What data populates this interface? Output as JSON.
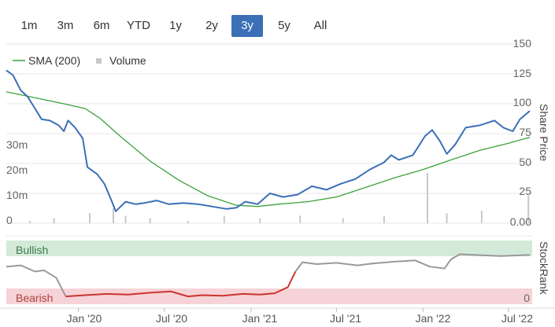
{
  "range_selector": {
    "buttons": [
      "1m",
      "3m",
      "6m",
      "YTD",
      "1y",
      "2y",
      "3y",
      "5y",
      "All"
    ],
    "active": "3y"
  },
  "colors": {
    "price": "#3b6fb6",
    "sma": "#3aa33a",
    "volume": "#c8c8c8",
    "rank": "#999999",
    "rank_red": "#cc3333",
    "bullish_band": "#d3ead9",
    "bearish_band": "#f6d3d6",
    "active_button": "#3b6fb6"
  },
  "chart_data": [
    {
      "type": "line",
      "legend": {
        "placement": "top-left",
        "items": [
          "SMA (200)",
          "Volume"
        ]
      },
      "y_axis_right": {
        "label": "Share Price",
        "ticks": [
          "0.00",
          "25",
          "50",
          "75",
          "100",
          "125",
          "150"
        ],
        "range": [
          0,
          150
        ]
      },
      "y_axis_left": {
        "label": "",
        "ticks": [
          "0",
          "10m",
          "20m",
          "30m"
        ],
        "range": [
          0,
          40
        ]
      },
      "x_axis": {
        "ticks": [
          "Jan '20",
          "Jul '20",
          "Jan '21",
          "Jul '21",
          "Jan '22",
          "Jul '22"
        ]
      },
      "x_range": [
        "2019-08-01",
        "2022-08-20"
      ],
      "grid": true,
      "series": [
        {
          "name": "Share Price",
          "points": [
            [
              "2019-08-01",
              128
            ],
            [
              "2019-08-15",
              124
            ],
            [
              "2019-09-01",
              111
            ],
            [
              "2019-09-15",
              106
            ],
            [
              "2019-10-01",
              96
            ],
            [
              "2019-10-15",
              87
            ],
            [
              "2019-11-01",
              86
            ],
            [
              "2019-11-20",
              82
            ],
            [
              "2019-12-01",
              77
            ],
            [
              "2019-12-10",
              86
            ],
            [
              "2019-12-25",
              80
            ],
            [
              "2020-01-10",
              71
            ],
            [
              "2020-01-20",
              47
            ],
            [
              "2020-02-10",
              41
            ],
            [
              "2020-02-25",
              33
            ],
            [
              "2020-03-10",
              20
            ],
            [
              "2020-03-20",
              10
            ],
            [
              "2020-04-10",
              18
            ],
            [
              "2020-05-01",
              16
            ],
            [
              "2020-05-20",
              17
            ],
            [
              "2020-06-15",
              19
            ],
            [
              "2020-07-10",
              16
            ],
            [
              "2020-08-10",
              17
            ],
            [
              "2020-09-10",
              16
            ],
            [
              "2020-10-10",
              14
            ],
            [
              "2020-11-10",
              12
            ],
            [
              "2020-12-01",
              13
            ],
            [
              "2020-12-20",
              18
            ],
            [
              "2021-01-15",
              16
            ],
            [
              "2021-02-10",
              25
            ],
            [
              "2021-03-10",
              22
            ],
            [
              "2021-04-10",
              24
            ],
            [
              "2021-05-10",
              31
            ],
            [
              "2021-06-10",
              28
            ],
            [
              "2021-07-10",
              33
            ],
            [
              "2021-08-10",
              37
            ],
            [
              "2021-09-10",
              45
            ],
            [
              "2021-10-10",
              51
            ],
            [
              "2021-10-25",
              57
            ],
            [
              "2021-11-10",
              53
            ],
            [
              "2021-12-10",
              57
            ],
            [
              "2022-01-05",
              73
            ],
            [
              "2022-01-20",
              78
            ],
            [
              "2022-02-05",
              69
            ],
            [
              "2022-02-20",
              58
            ],
            [
              "2022-03-10",
              66
            ],
            [
              "2022-04-01",
              80
            ],
            [
              "2022-05-01",
              82
            ],
            [
              "2022-06-01",
              86
            ],
            [
              "2022-06-20",
              80
            ],
            [
              "2022-07-10",
              77
            ],
            [
              "2022-07-25",
              87
            ],
            [
              "2022-08-15",
              94
            ]
          ]
        },
        {
          "name": "SMA (200)",
          "points": [
            [
              "2019-08-01",
              110
            ],
            [
              "2019-10-01",
              105
            ],
            [
              "2019-12-01",
              100
            ],
            [
              "2020-01-15",
              96
            ],
            [
              "2020-02-15",
              88
            ],
            [
              "2020-04-01",
              72
            ],
            [
              "2020-06-01",
              52
            ],
            [
              "2020-08-01",
              36
            ],
            [
              "2020-10-01",
              23
            ],
            [
              "2020-12-01",
              15
            ],
            [
              "2021-01-15",
              14
            ],
            [
              "2021-03-01",
              16
            ],
            [
              "2021-05-01",
              18
            ],
            [
              "2021-07-01",
              22
            ],
            [
              "2021-09-01",
              30
            ],
            [
              "2021-11-01",
              38
            ],
            [
              "2022-01-01",
              45
            ],
            [
              "2022-03-01",
              53
            ],
            [
              "2022-05-01",
              61
            ],
            [
              "2022-07-01",
              67
            ],
            [
              "2022-08-15",
              72
            ]
          ]
        },
        {
          "name": "Volume",
          "type": "bar",
          "points": [
            [
              "2019-09-20",
              1
            ],
            [
              "2019-11-10",
              2
            ],
            [
              "2020-01-25",
              4
            ],
            [
              "2020-03-15",
              6
            ],
            [
              "2020-04-10",
              3
            ],
            [
              "2020-06-01",
              2
            ],
            [
              "2020-08-20",
              1
            ],
            [
              "2020-11-05",
              3
            ],
            [
              "2021-01-20",
              2
            ],
            [
              "2021-04-15",
              3
            ],
            [
              "2021-07-15",
              2
            ],
            [
              "2021-10-10",
              3
            ],
            [
              "2022-01-10",
              20
            ],
            [
              "2022-02-20",
              4
            ],
            [
              "2022-05-05",
              5
            ],
            [
              "2022-08-12",
              11
            ]
          ]
        }
      ]
    },
    {
      "type": "line",
      "y_axis_right": {
        "label": "StockRank",
        "ticks": [
          "0"
        ],
        "range": [
          0,
          100
        ]
      },
      "bands": [
        "Bullish",
        "Bearish"
      ],
      "series": [
        {
          "name": "StockRank",
          "points": [
            [
              "2019-08-01",
              58
            ],
            [
              "2019-09-01",
              60
            ],
            [
              "2019-10-01",
              50
            ],
            [
              "2019-10-20",
              52
            ],
            [
              "2019-11-15",
              40
            ],
            [
              "2019-12-05",
              10
            ],
            [
              "2020-01-15",
              12
            ],
            [
              "2020-03-01",
              14
            ],
            [
              "2020-04-15",
              13
            ],
            [
              "2020-06-01",
              16
            ],
            [
              "2020-07-15",
              18
            ],
            [
              "2020-08-20",
              10
            ],
            [
              "2020-09-20",
              12
            ],
            [
              "2020-11-01",
              11
            ],
            [
              "2020-12-15",
              14
            ],
            [
              "2021-01-20",
              13
            ],
            [
              "2021-02-20",
              15
            ],
            [
              "2021-03-20",
              25
            ],
            [
              "2021-04-05",
              50
            ],
            [
              "2021-04-20",
              65
            ],
            [
              "2021-05-20",
              62
            ],
            [
              "2021-07-01",
              64
            ],
            [
              "2021-08-15",
              60
            ],
            [
              "2021-09-15",
              63
            ],
            [
              "2021-11-01",
              66
            ],
            [
              "2021-12-15",
              68
            ],
            [
              "2022-01-15",
              58
            ],
            [
              "2022-02-15",
              55
            ],
            [
              "2022-03-01",
              70
            ],
            [
              "2022-03-20",
              78
            ],
            [
              "2022-05-15",
              76
            ],
            [
              "2022-06-15",
              75
            ],
            [
              "2022-08-15",
              77
            ]
          ]
        }
      ]
    }
  ]
}
